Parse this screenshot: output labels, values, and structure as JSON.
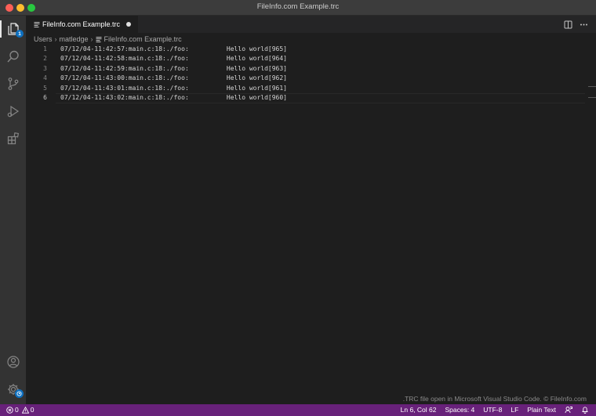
{
  "window": {
    "title": "FileInfo.com Example.trc"
  },
  "activity_bar": {
    "explorer_badge": "1"
  },
  "tab": {
    "label": "FileInfo.com Example.trc"
  },
  "breadcrumb": {
    "items": [
      "Users",
      "matledge",
      "FileInfo.com Example.trc"
    ]
  },
  "editor": {
    "lines": [
      {
        "number": "1",
        "text": "07/12/04-11:42:57:main.c:18:./foo:          Hello world[965]"
      },
      {
        "number": "2",
        "text": "07/12/04-11:42:58:main.c:18:./foo:          Hello world[964]"
      },
      {
        "number": "3",
        "text": "07/12/04-11:42:59:main.c:18:./foo:          Hello world[963]"
      },
      {
        "number": "4",
        "text": "07/12/04-11:43:00:main.c:18:./foo:          Hello world[962]"
      },
      {
        "number": "5",
        "text": "07/12/04-11:43:01:main.c:18:./foo:          Hello world[961]"
      },
      {
        "number": "6",
        "text": "07/12/04-11:43:02:main.c:18:./foo:          Hello world[960]"
      }
    ]
  },
  "watermark": ".TRC file open in Microsoft Visual Studio Code. © FileInfo.com",
  "statusbar": {
    "errors": "0",
    "warnings": "0",
    "position": "Ln 6, Col 62",
    "spaces": "Spaces: 4",
    "encoding": "UTF-8",
    "eol": "LF",
    "language": "Plain Text"
  },
  "colors": {
    "statusbar": "#68217a",
    "editor_bg": "#1e1e1e",
    "activity_bar": "#333333",
    "badge": "#0e70c0"
  }
}
